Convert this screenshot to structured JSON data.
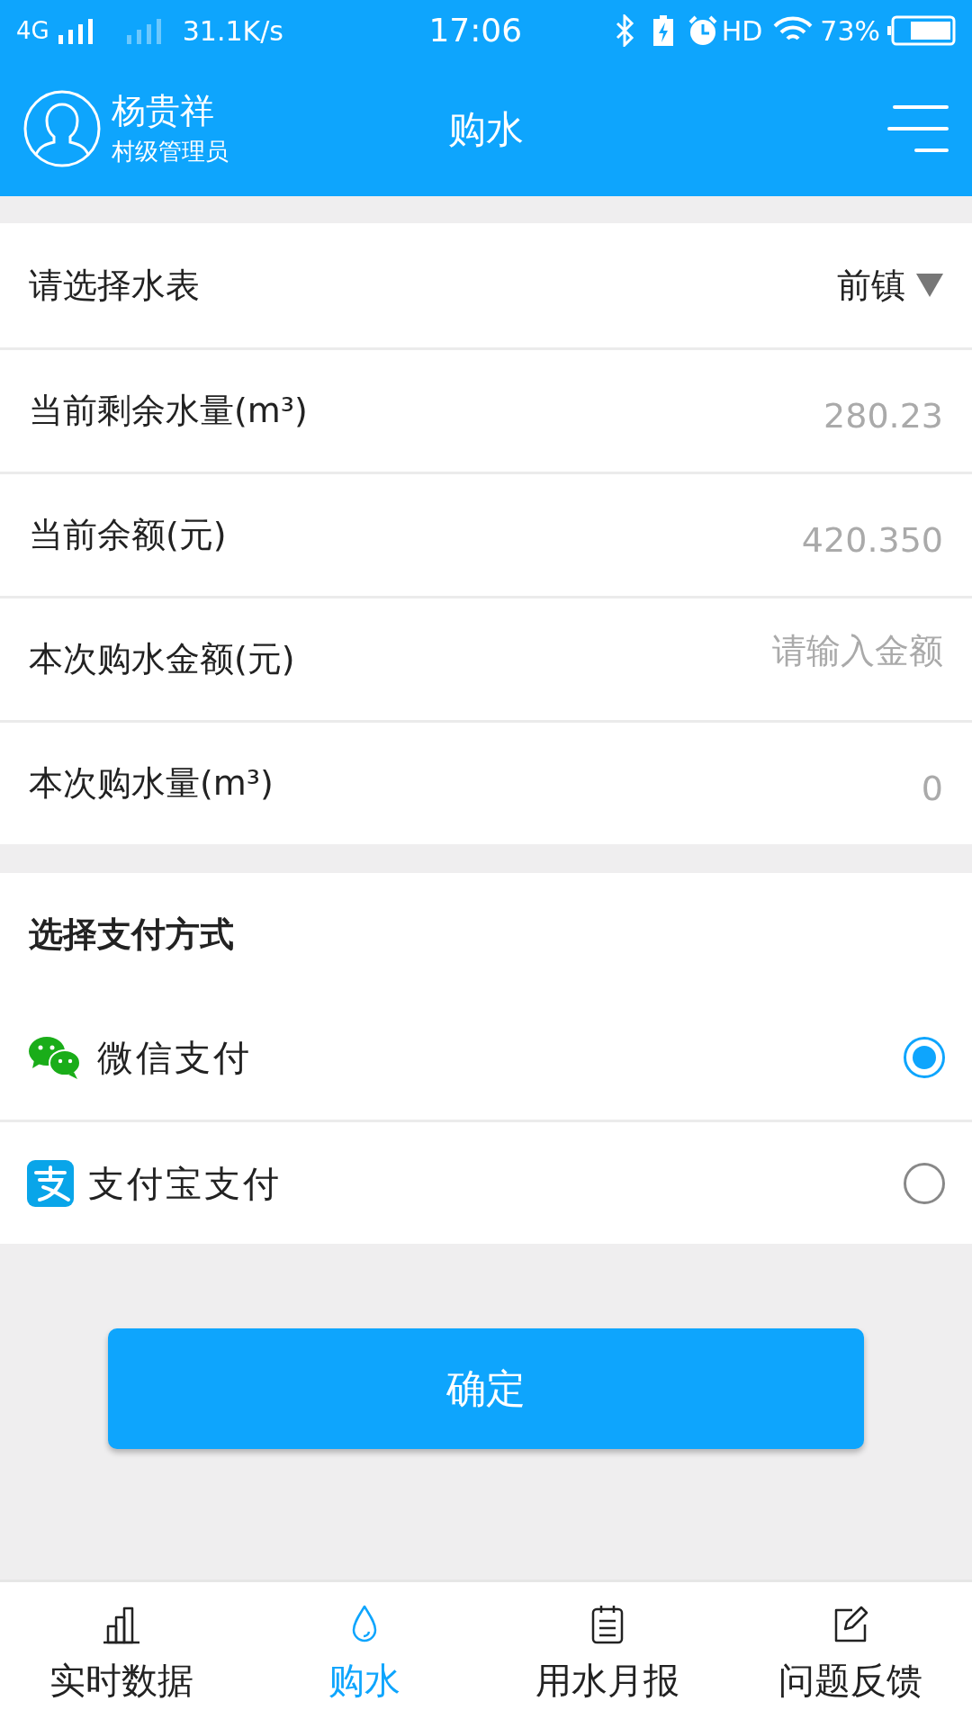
{
  "status_bar": {
    "network": "4G",
    "speed": "31.1K/s",
    "time": "17:06",
    "hd": "HD",
    "battery": "73%"
  },
  "header": {
    "user_name": "杨贵祥",
    "user_role": "村级管理员",
    "title": "购水"
  },
  "fields": [
    {
      "kind": "select",
      "label": "请选择水表",
      "value": "前镇"
    },
    {
      "kind": "value",
      "label": "当前剩余水量(m³)",
      "value": "280.23"
    },
    {
      "kind": "value",
      "label": "当前余额(元)",
      "value": "420.350"
    },
    {
      "kind": "input",
      "label": "本次购水金额(元)",
      "placeholder": "请输入金额"
    },
    {
      "kind": "value",
      "label": "本次购水量(m³)",
      "value": "0"
    }
  ],
  "payment": {
    "title": "选择支付方式",
    "methods": [
      {
        "kind": "wechat",
        "label": "微信支付",
        "selected": true
      },
      {
        "kind": "alipay",
        "label": "支付宝支付",
        "selected": false
      }
    ]
  },
  "confirm_button": "确定",
  "nav": [
    {
      "kind": "chart",
      "label": "实时数据",
      "selected": false
    },
    {
      "kind": "drop",
      "label": "购水",
      "selected": true
    },
    {
      "kind": "notepad",
      "label": "用水月报",
      "selected": false
    },
    {
      "kind": "edit",
      "label": "问题反馈",
      "selected": false
    }
  ]
}
